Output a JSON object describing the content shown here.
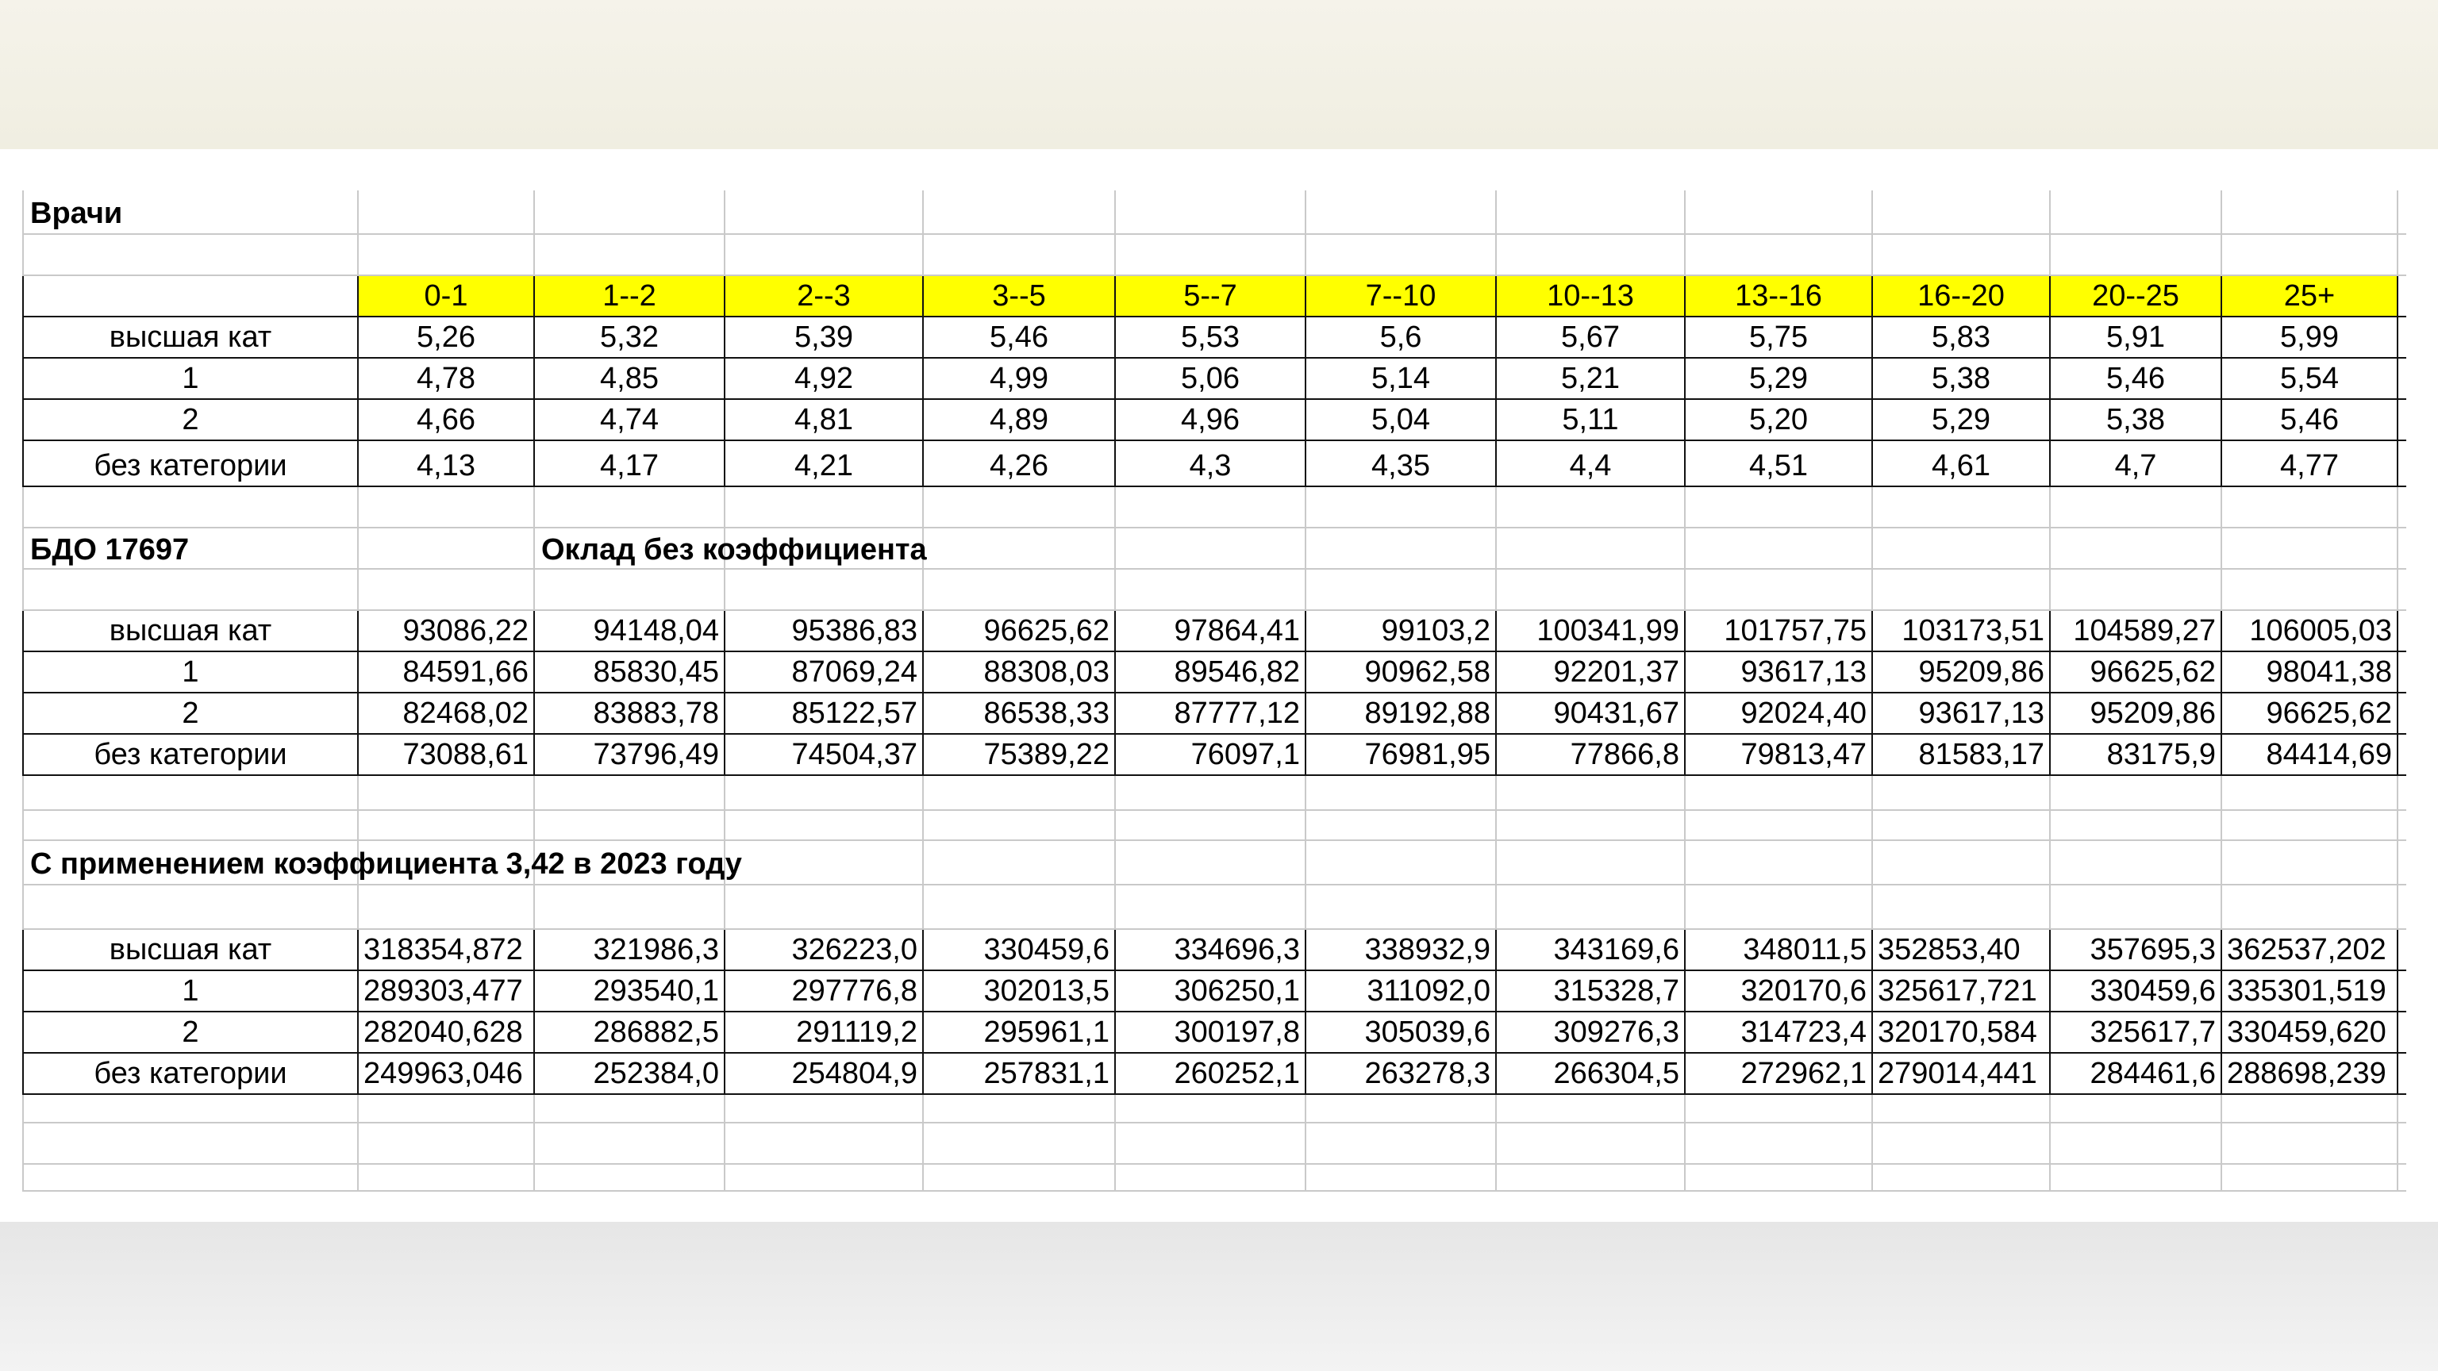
{
  "section1": {
    "title": "Врачи",
    "header": [
      "0-1",
      "1--2",
      "2--3",
      "3--5",
      "5--7",
      "7--10",
      "10--13",
      "13--16",
      "16--20",
      "20--25",
      "25+"
    ],
    "rows": [
      {
        "label": "высшая кат",
        "values": [
          "5,26",
          "5,32",
          "5,39",
          "5,46",
          "5,53",
          "5,6",
          "5,67",
          "5,75",
          "5,83",
          "5,91",
          "5,99"
        ]
      },
      {
        "label": "1",
        "values": [
          "4,78",
          "4,85",
          "4,92",
          "4,99",
          "5,06",
          "5,14",
          "5,21",
          "5,29",
          "5,38",
          "5,46",
          "5,54"
        ]
      },
      {
        "label": "2",
        "values": [
          "4,66",
          "4,74",
          "4,81",
          "4,89",
          "4,96",
          "5,04",
          "5,11",
          "5,20",
          "5,29",
          "5,38",
          "5,46"
        ]
      },
      {
        "label": "без категории",
        "values": [
          "4,13",
          "4,17",
          "4,21",
          "4,26",
          "4,3",
          "4,35",
          "4,4",
          "4,51",
          "4,61",
          "4,7",
          "4,77"
        ]
      }
    ]
  },
  "section2": {
    "title": "БДО 17697",
    "subtitle": "Оклад без коэффициента",
    "rows": [
      {
        "label": "высшая кат",
        "values": [
          "93086,22",
          "94148,04",
          "95386,83",
          "96625,62",
          "97864,41",
          "99103,2",
          "100341,99",
          "101757,75",
          "103173,51",
          "104589,27",
          "106005,03"
        ]
      },
      {
        "label": "1",
        "values": [
          "84591,66",
          "85830,45",
          "87069,24",
          "88308,03",
          "89546,82",
          "90962,58",
          "92201,37",
          "93617,13",
          "95209,86",
          "96625,62",
          "98041,38"
        ]
      },
      {
        "label": "2",
        "values": [
          "82468,02",
          "83883,78",
          "85122,57",
          "86538,33",
          "87777,12",
          "89192,88",
          "90431,67",
          "92024,40",
          "93617,13",
          "95209,86",
          "96625,62"
        ]
      },
      {
        "label": "без категории",
        "values": [
          "73088,61",
          "73796,49",
          "74504,37",
          "75389,22",
          "76097,1",
          "76981,95",
          "77866,8",
          "79813,47",
          "81583,17",
          "83175,9",
          "84414,69"
        ]
      }
    ]
  },
  "section3": {
    "title": "С применением коэффициента 3,42 в 2023 году",
    "rows": [
      {
        "label": "высшая кат",
        "values": [
          "318354,872",
          "321986,3",
          "326223,0",
          "330459,6",
          "334696,3",
          "338932,9",
          "343169,6",
          "348011,5",
          "352853,40",
          "357695,3",
          "362537,202"
        ]
      },
      {
        "label": "1",
        "values": [
          "289303,477",
          "293540,1",
          "297776,8",
          "302013,5",
          "306250,1",
          "311092,0",
          "315328,7",
          "320170,6",
          "325617,721",
          "330459,6",
          "335301,519"
        ]
      },
      {
        "label": "2",
        "values": [
          "282040,628",
          "286882,5",
          "291119,2",
          "295961,1",
          "300197,8",
          "305039,6",
          "309276,3",
          "314723,4",
          "320170,584",
          "325617,7",
          "330459,620"
        ]
      },
      {
        "label": "без категории",
        "values": [
          "249963,046",
          "252384,0",
          "254804,9",
          "257831,1",
          "260252,1",
          "263278,3",
          "266304,5",
          "272962,1",
          "279014,441",
          "284461,6",
          "288698,239"
        ]
      }
    ]
  }
}
